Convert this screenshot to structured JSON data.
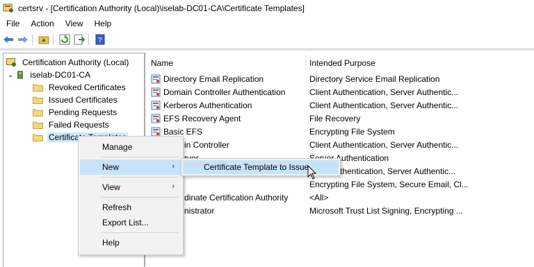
{
  "window": {
    "title": "certsrv - [Certification Authority (Local)\\iselab-DC01-CA\\Certificate Templates]"
  },
  "menubar": {
    "items": [
      "File",
      "Action",
      "View",
      "Help"
    ]
  },
  "toolbar": {
    "buttons": [
      "back-arrow-icon",
      "forward-arrow-icon",
      "up-folder-icon",
      "refresh-icon",
      "export-list-icon",
      "help-book-icon"
    ]
  },
  "tree": {
    "root": "Certification Authority (Local)",
    "ca": "iselab-DC01-CA",
    "folders": [
      "Revoked Certificates",
      "Issued Certificates",
      "Pending Requests",
      "Failed Requests",
      "Certificate Templates"
    ]
  },
  "list": {
    "columns": {
      "name": "Name",
      "purpose": "Intended Purpose"
    },
    "rows": [
      {
        "name": "Directory Email Replication",
        "purpose": "Directory Service Email Replication"
      },
      {
        "name": "Domain Controller Authentication",
        "purpose": "Client Authentication, Server Authentic..."
      },
      {
        "name": "Kerberos Authentication",
        "purpose": "Client Authentication, Server Authentic..."
      },
      {
        "name": "EFS Recovery Agent",
        "purpose": "File Recovery"
      },
      {
        "name": "Basic EFS",
        "purpose": "Encrypting File System"
      },
      {
        "name": "in Controller",
        "purpose": "Client Authentication, Server Authentic..."
      },
      {
        "name": "rver",
        "purpose": "Server Authentication"
      },
      {
        "name": "",
        "purpose": "thentication, Server Authentic..."
      },
      {
        "name": "",
        "purpose": "Encrypting File System, Secure Email, Cl..."
      },
      {
        "name": "dinate Certification Authority",
        "purpose": "<All>"
      },
      {
        "name": "nistrator",
        "purpose": "Microsoft Trust List Signing, Encrypting ..."
      }
    ]
  },
  "context_menu": {
    "items": [
      "Manage",
      "New",
      "View",
      "Refresh",
      "Export List...",
      "Help"
    ],
    "highlighted": "New"
  },
  "submenu": {
    "item": "Certificate Template to Issue"
  },
  "colors": {
    "selection": "#cce8ff",
    "menu_highlight": "#c6e3fa",
    "menu_bg": "#f2f2f2"
  }
}
